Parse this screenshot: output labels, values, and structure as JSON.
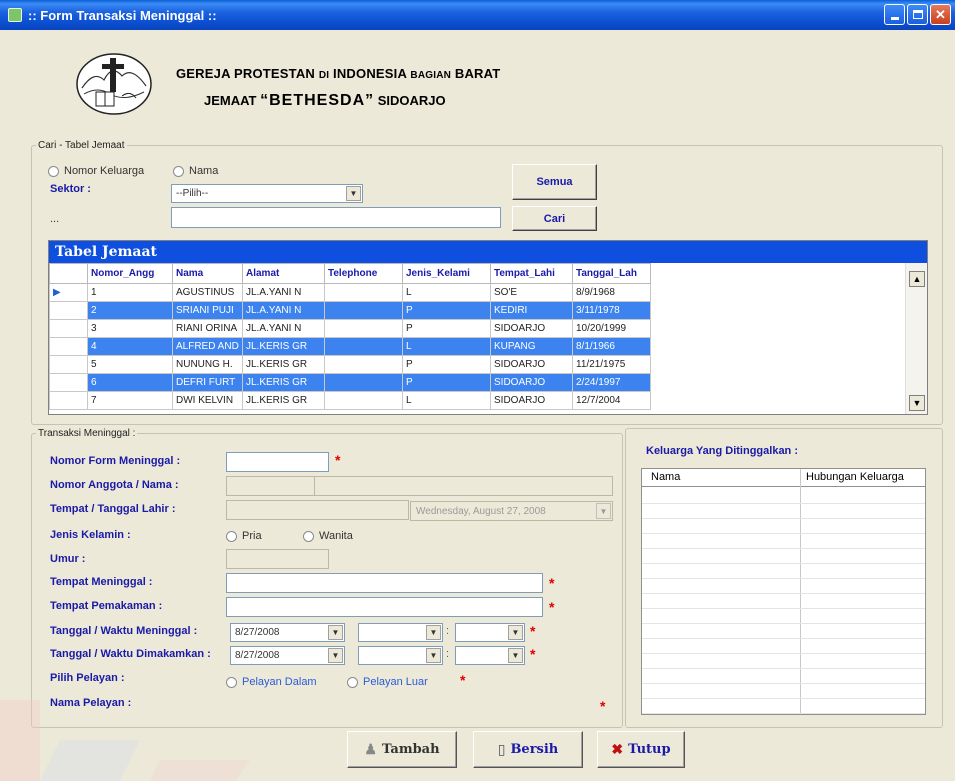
{
  "window": {
    "title": ":: Form Transaksi Meninggal ::"
  },
  "header": {
    "line1_a": "GEREJA PROTESTAN",
    "line1_b": "DI",
    "line1_c": "INDONESIA",
    "line1_d": "BAGIAN",
    "line1_e": "BARAT",
    "line2_a": "JEMAAT",
    "line2_b": "“BETHESDA”",
    "line2_c": "SIDOARJO"
  },
  "search": {
    "legend": "Cari - Tabel Jemaat",
    "radio_nomor": "Nomor Keluarga",
    "radio_nama": "Nama",
    "sektor_label": "Sektor :",
    "sektor_value": "--Pilih--",
    "ellipsis": "...",
    "semua_button": "Semua",
    "cari_button": "Cari"
  },
  "table": {
    "caption": "Tabel Jemaat",
    "columns": [
      "Nomor_Angg",
      "Nama",
      "Alamat",
      "Telephone",
      "Jenis_Kelami",
      "Tempat_Lahi",
      "Tanggal_Lah"
    ],
    "rows": [
      [
        "1",
        "AGUSTINUS",
        "JL.A.YANI N",
        "",
        "L",
        "SO'E",
        "8/9/1968"
      ],
      [
        "2",
        "SRIANI PUJI",
        "JL.A.YANI N",
        "",
        "P",
        "KEDIRI",
        "3/11/1978"
      ],
      [
        "3",
        "RIANI ORINA",
        "JL.A.YANI N",
        "",
        "P",
        "SIDOARJO",
        "10/20/1999"
      ],
      [
        "4",
        "ALFRED AND",
        "JL.KERIS GR",
        "",
        "L",
        "KUPANG",
        "8/1/1966"
      ],
      [
        "5",
        "NUNUNG H.",
        "JL.KERIS GR",
        "",
        "P",
        "SIDOARJO",
        "11/21/1975"
      ],
      [
        "6",
        "DEFRI FURT",
        "JL.KERIS GR",
        "",
        "P",
        "SIDOARJO",
        "2/24/1997"
      ],
      [
        "7",
        "DWI KELVIN",
        "JL.KERIS GR",
        "",
        "L",
        "SIDOARJO",
        "12/7/2004"
      ]
    ],
    "selected_rows": [
      1,
      3,
      5
    ],
    "current_row_marker": "▶"
  },
  "trans": {
    "legend": "Transaksi Meninggal :",
    "nomor_form_label": "Nomor Form Meninggal :",
    "nomor_anggota_label": "Nomor Anggota / Nama :",
    "tempat_tanggal_label": "Tempat / Tanggal Lahir :",
    "tanggal_lahir_value": "Wednesday,   August   27, 2008",
    "jenis_kelamin_label": "Jenis Kelamin :",
    "pria": "Pria",
    "wanita": "Wanita",
    "umur_label": "Umur :",
    "tempat_meninggal_label": "Tempat Meninggal :",
    "tempat_pemakaman_label": "Tempat Pemakaman :",
    "tgl_meninggal_label": "Tanggal / Waktu Meninggal :",
    "tgl_dimakamkan_label": "Tanggal / Waktu Dimakamkan :",
    "tgl_meninggal_value": "8/27/2008",
    "tgl_dimakamkan_value": "8/27/2008",
    "pilih_pelayan_label": "Pilih Pelayan :",
    "pelayan_dalam": "Pelayan Dalam",
    "pelayan_luar": "Pelayan Luar",
    "nama_pelayan_label": "Nama Pelayan :",
    "time_sep": ":",
    "required_mark": "*"
  },
  "keluarga": {
    "title": "Keluarga Yang Ditinggalkan :",
    "col_nama": "Nama",
    "col_hubungan": "Hubungan Keluarga"
  },
  "buttons": {
    "tambah": "Tambah",
    "bersih": "Bersih",
    "tutup": "Tutup"
  },
  "colors": {
    "accent": "#0f4fe0",
    "selected_row": "#3c83f0",
    "label_blue": "#1a1aa8",
    "required": "#e00000"
  }
}
